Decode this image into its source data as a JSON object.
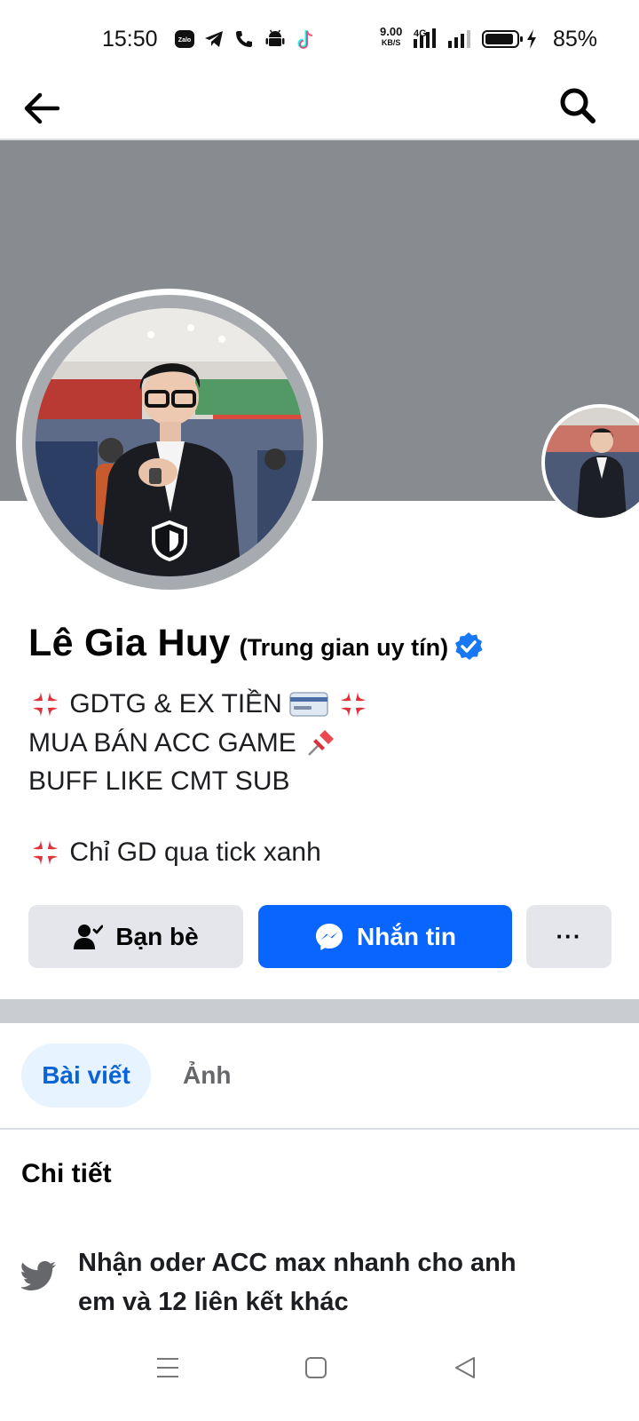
{
  "status_bar": {
    "time": "15:50",
    "net_speed": "9.00",
    "net_unit": "KB/S",
    "network_type": "4G",
    "battery_percent": "85%",
    "icons": [
      "zalo-icon",
      "telegram-icon",
      "phone-icon",
      "android-icon",
      "tiktok-icon",
      "signal-icon",
      "battery-icon",
      "charging-icon"
    ],
    "zalo_label": "Zalo"
  },
  "nav": {
    "back_icon": "back-arrow-icon",
    "search_icon": "search-icon"
  },
  "profile": {
    "name": "Lê Gia Huy",
    "name_suffix": "(Trung gian uy tín)",
    "verified_color": "#1877f2",
    "bio_lines": [
      "GDTG & EX TIỀN",
      "MUA BÁN ACC GAME",
      "BUFF LIKE CMT SUB",
      "Chỉ GD qua tick xanh"
    ]
  },
  "actions": {
    "friends_label": "Bạn bè",
    "message_label": "Nhắn tin",
    "more_label": "···"
  },
  "tabs": [
    {
      "label": "Bài viết",
      "active": true
    },
    {
      "label": "Ảnh",
      "active": false
    }
  ],
  "details": {
    "title": "Chi tiết",
    "link_line1": "Nhận oder ACC max nhanh cho anh",
    "link_line2": "em và 12 liên kết khác"
  },
  "colors": {
    "accent": "#0866ff",
    "cover": "#888b90",
    "tab_active_bg": "#e7f3ff",
    "tab_active_text": "#0a64d6"
  }
}
